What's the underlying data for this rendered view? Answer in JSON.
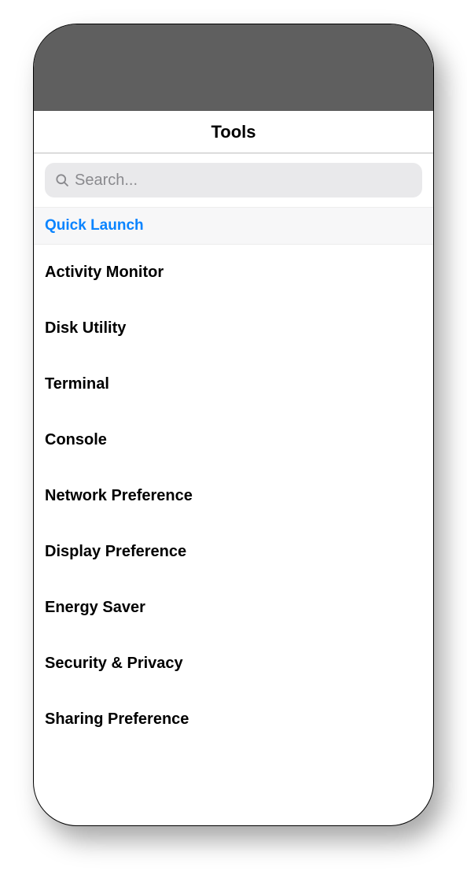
{
  "header": {
    "title": "Tools"
  },
  "search": {
    "placeholder": "Search..."
  },
  "section": {
    "title": "Quick Launch"
  },
  "items": [
    {
      "label": "Activity Monitor"
    },
    {
      "label": "Disk Utility"
    },
    {
      "label": "Terminal"
    },
    {
      "label": "Console"
    },
    {
      "label": "Network Preference"
    },
    {
      "label": "Display Preference"
    },
    {
      "label": "Energy Saver"
    },
    {
      "label": "Security & Privacy"
    },
    {
      "label": "Sharing Preference"
    }
  ]
}
